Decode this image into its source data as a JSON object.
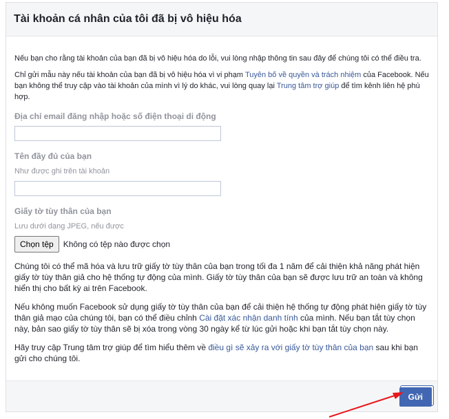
{
  "header": {
    "title": "Tài khoản cá nhân của tôi đã bị vô hiệu hóa"
  },
  "intro": "Nếu bạn cho rằng tài khoản của bạn đã bị vô hiệu hóa do lỗi, vui lòng nhập thông tin sau đây để chúng tôi có thể điều tra.",
  "notice": {
    "part1": "Chỉ gửi mẫu này nếu tài khoản của bạn đã bị vô hiệu hóa vì vi phạm ",
    "link1": "Tuyên bố về quyền và trách nhiệm",
    "part2": " của Facebook. Nếu bạn không thể truy cập vào tài khoản của mình vì lý do khác, vui lòng quay lại ",
    "link2": "Trung tâm trợ giúp",
    "part3": " để tìm kênh liên hệ phù hợp."
  },
  "fields": {
    "email_label": "Địa chỉ email đăng nhập hoặc số điện thoại di động",
    "email_value": "",
    "name_label": "Tên đầy đủ của bạn",
    "name_hint": "Như được ghi trên tài khoản",
    "name_value": "",
    "id_label": "Giấy tờ tùy thân của bạn",
    "id_hint": "Lưu dưới dạng JPEG, nếu được",
    "file_button": "Chọn tệp",
    "file_status": "Không có tệp nào được chọn"
  },
  "body": {
    "p1": "Chúng tôi có thể mã hóa và lưu trữ giấy tờ tùy thân của bạn trong tối đa 1 năm để cải thiện khả năng phát hiện giấy tờ tùy thân giả cho hệ thống tự động của mình. Giấy tờ tùy thân của bạn sẽ được lưu trữ an toàn và không hiển thị cho bất kỳ ai trên Facebook.",
    "p2_part1": "Nếu không muốn Facebook sử dụng giấy tờ tùy thân của bạn để cải thiện hệ thống tự động phát hiện giấy tờ tùy thân giả mạo của chúng tôi, bạn có thể điều chỉnh ",
    "p2_link": "Cài đặt xác nhận danh tính",
    "p2_part2": " của mình. Nếu bạn tắt tùy chọn này, bản sao giấy tờ tùy thân sẽ bị xóa trong vòng 30 ngày kể từ lúc gửi hoặc khi bạn tắt tùy chọn này.",
    "p3_part1": "Hãy truy cập Trung tâm trợ giúp để tìm hiểu thêm về ",
    "p3_link": "điều gì sẽ xảy ra với giấy tờ tùy thân của bạn",
    "p3_part2": " sau khi bạn gửi cho chúng tôi."
  },
  "footer": {
    "submit_label": "Gửi"
  },
  "colors": {
    "accent": "#4267b2",
    "link": "#385898",
    "annotation": "#e8161b"
  }
}
